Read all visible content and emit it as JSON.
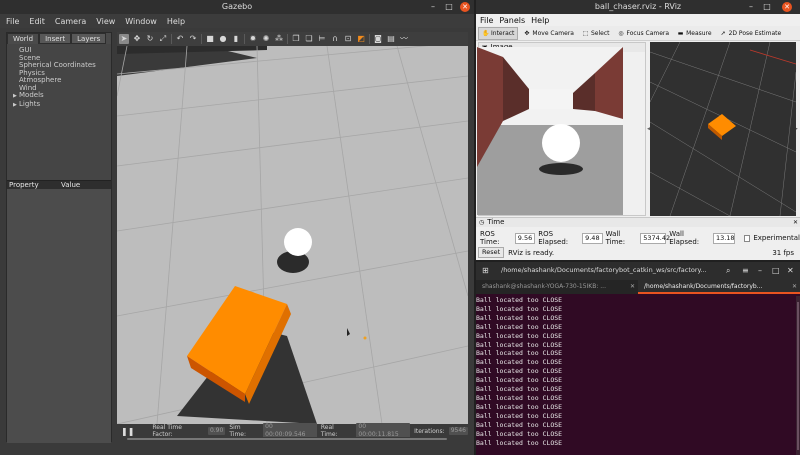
{
  "gazebo": {
    "title": "Gazebo",
    "menu": [
      "File",
      "Edit",
      "Camera",
      "View",
      "Window",
      "Help"
    ],
    "tabs": [
      "World",
      "Insert",
      "Layers"
    ],
    "tree": [
      "GUI",
      "Scene",
      "Spherical Coordinates",
      "Physics",
      "Atmosphere",
      "Wind",
      "Models",
      "Lights"
    ],
    "tree_expandable": [
      "Models",
      "Lights"
    ],
    "property_header": {
      "property": "Property",
      "value": "Value"
    },
    "status": {
      "rtf_label": "Real Time Factor:",
      "rtf_value": "0.90",
      "sim_label": "Sim Time:",
      "sim_value": "00 00:00:09.546",
      "real_label": "Real Time:",
      "real_value": "00 00:00:11.815",
      "iter_label": "Iterations:",
      "iter_value": "9546"
    },
    "colors": {
      "box": "#ff8c00",
      "floor": "#bcbcbc",
      "ball": "#ffffff"
    }
  },
  "rviz": {
    "title": "ball_chaser.rviz - RViz",
    "menu": [
      "File",
      "Panels",
      "Help"
    ],
    "toolbar": [
      {
        "icon": "interact-icon",
        "label": "Interact",
        "selected": true
      },
      {
        "icon": "move-camera-icon",
        "label": "Move Camera",
        "selected": false
      },
      {
        "icon": "select-icon",
        "label": "Select",
        "selected": false
      },
      {
        "icon": "focus-camera-icon",
        "label": "Focus Camera",
        "selected": false
      },
      {
        "icon": "measure-icon",
        "label": "Measure",
        "selected": false
      },
      {
        "icon": "pose-estimate-icon",
        "label": "2D Pose Estimate",
        "selected": false
      }
    ],
    "image_panel_title": "Image",
    "time_panel_title": "Time",
    "time": {
      "ros_time_label": "ROS Time:",
      "ros_time": "9.56",
      "ros_elapsed_label": "ROS Elapsed:",
      "ros_elapsed": "9.48",
      "wall_time_label": "Wall Time:",
      "wall_time": "5374.42",
      "wall_elapsed_label": "Wall Elapsed:",
      "wall_elapsed": "13.18",
      "experimental_label": "Experimental"
    },
    "reset_label": "Reset",
    "status_text": "RViz is ready.",
    "fps": "31 fps"
  },
  "terminal": {
    "title": "/home/shashank/Documents/factorybot_catkin_ws/src/factory...",
    "tabs": [
      {
        "label": "shashank@shashank-YOGA-730-15IKB: ...",
        "active": false
      },
      {
        "label": "/home/shashank/Documents/factoryb...",
        "active": true
      }
    ],
    "lines": [
      "Ball located too CLOSE",
      "Ball located too CLOSE",
      "Ball located too CLOSE",
      "Ball located too CLOSE",
      "Ball located too CLOSE",
      "Ball located too CLOSE",
      "Ball located too CLOSE",
      "Ball located too CLOSE",
      "Ball located too CLOSE",
      "Ball located too CLOSE",
      "Ball located too CLOSE",
      "Ball located too CLOSE",
      "Ball located too CLOSE",
      "Ball located too CLOSE",
      "Ball located too CLOSE",
      "Ball located too CLOSE",
      "Ball located too CLOSE"
    ],
    "colors": {
      "background": "#300a24",
      "accent": "#e95420"
    }
  }
}
